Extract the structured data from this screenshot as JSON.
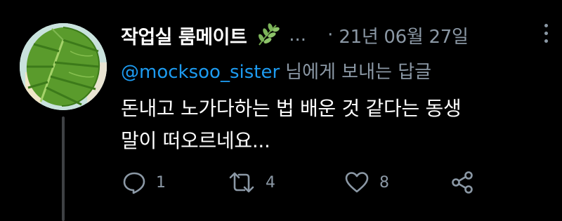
{
  "tweet": {
    "display_name": "작업실 룸메이트",
    "name_emoji": "herb-icon",
    "handle_truncated": "...",
    "separator": "·",
    "date": "21년 06월 27일",
    "reply_to_handle": "@mocksoo_sister",
    "reply_to_suffix": "님에게 보내는 답글",
    "text_lines": [
      "돈내고 노가다하는 법 배운 것 같다는 동생",
      "말이 떠오르네요..."
    ]
  },
  "actions": {
    "reply_count": "1",
    "retweet_count": "4",
    "like_count": "8"
  },
  "colors": {
    "background": "#000000",
    "text": "#ffffff",
    "secondary": "#8b98a5",
    "mention": "#1d9bf0",
    "thread_line": "#3e4144"
  }
}
